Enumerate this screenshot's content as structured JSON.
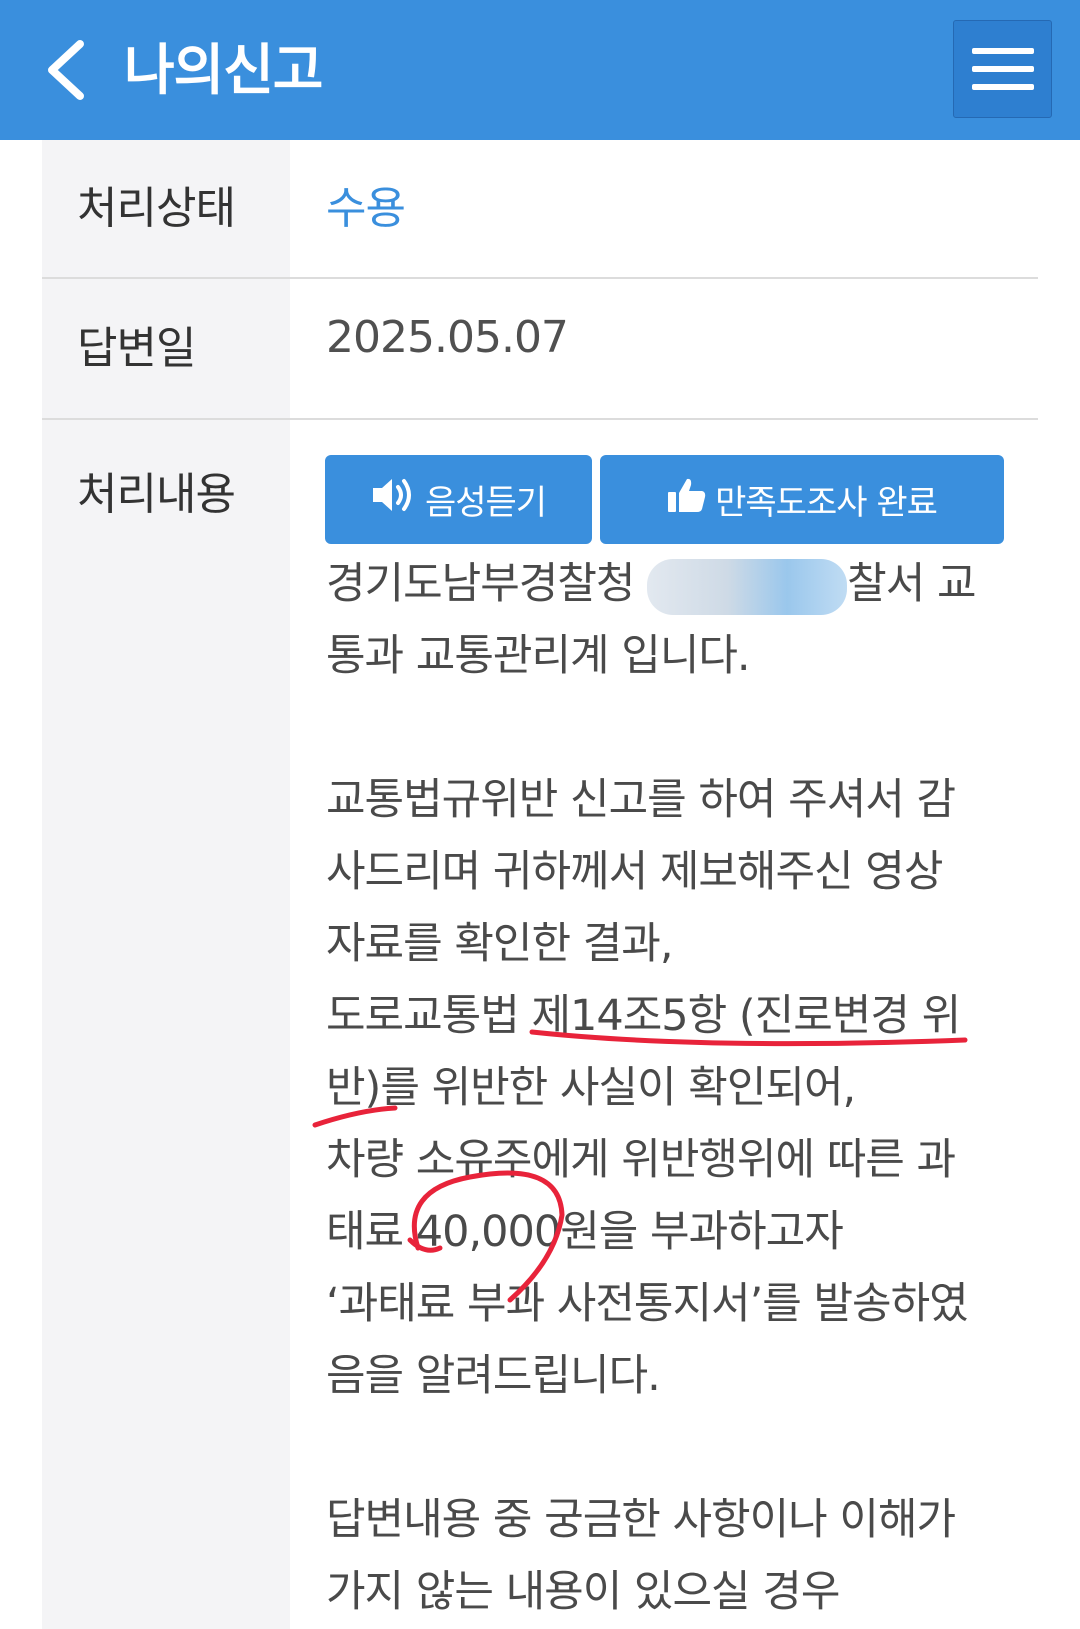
{
  "header": {
    "title": "나의신고",
    "back_icon": "chevron-left-icon",
    "menu_icon": "hamburger-menu-icon",
    "color": "#3a8fdd"
  },
  "rows": {
    "status": {
      "label": "처리상태",
      "value": "수용",
      "value_color": "#3a8fdd"
    },
    "answer_date": {
      "label": "답변일",
      "value": "2025.05.07"
    },
    "content": {
      "label": "처리내용"
    }
  },
  "buttons": {
    "audio": {
      "label": "음성듣기",
      "icon": "speaker-icon"
    },
    "survey": {
      "label": "만족도조사 완료",
      "icon": "thumbs-up-icon"
    }
  },
  "content": {
    "line1_prefix": "경기도남부경찰청",
    "line1_suffix": "찰서 교",
    "line2": "통과 교통관리계 입니다.",
    "para2": [
      "교통법규위반 신고를 하여 주셔서 감",
      "사드리며 귀하께서 제보해주신 영상",
      "자료를 확인한 결과,",
      "도로교통법 제14조5항 (진로변경 위",
      "반)를 위반한 사실이 확인되어,",
      "차량 소유주에게 위반행위에 따른 과",
      "태료 40,000원을 부과하고자",
      "‘과태료 부과 사전통지서’를 발송하였",
      "음을 알려드립니다."
    ],
    "para3": [
      "답변내용 중 궁금한 사항이나 이해가",
      "가지 않는 내용이 있으실 경우"
    ]
  }
}
